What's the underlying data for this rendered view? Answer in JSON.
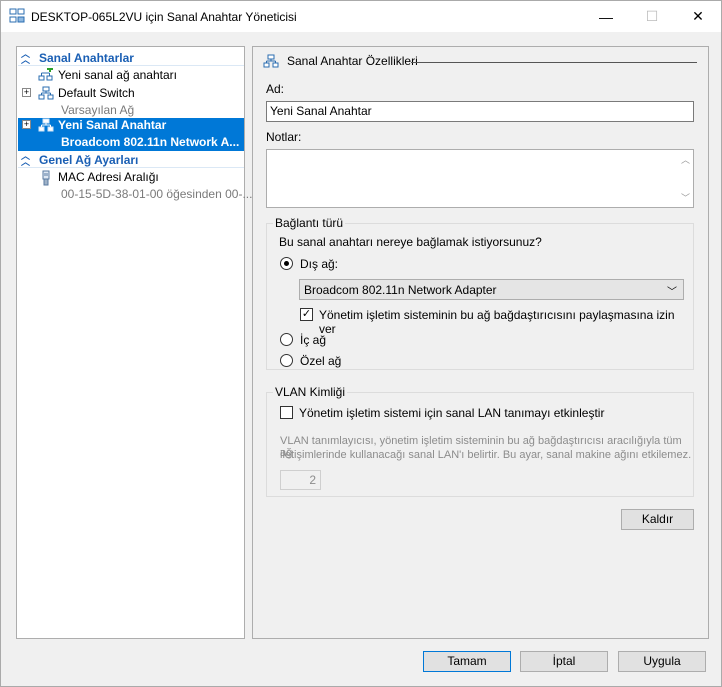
{
  "window": {
    "title": "DESKTOP-065L2VU için Sanal Anahtar Yöneticisi",
    "minimize": "—",
    "maximize": "☐",
    "close": "✕"
  },
  "tree": {
    "section1": "Sanal Anahtarlar",
    "new_switch": "Yeni sanal ağ anahtarı",
    "default_switch": "Default Switch",
    "default_switch_sub": "Varsayılan Ağ",
    "selected_switch": "Yeni Sanal Anahtar",
    "selected_switch_sub": "Broadcom 802.11n Network A...",
    "section2": "Genel Ağ Ayarları",
    "mac_range": "MAC Adresi Aralığı",
    "mac_range_sub": "00-15-5D-38-01-00 öğesinden 00-..."
  },
  "props": {
    "header": "Sanal Anahtar Özellikleri",
    "name_label": "Ad:",
    "name_value": "Yeni Sanal Anahtar",
    "notes_label": "Notlar:",
    "connection_group": "Bağlantı türü",
    "connection_question": "Bu sanal anahtarı nereye bağlamak istiyorsunuz?",
    "external": "Dış ağ:",
    "adapter": "Broadcom 802.11n Network Adapter",
    "allow_share": "Yönetim işletim sisteminin bu ağ bağdaştırıcısını paylaşmasına izin ver",
    "internal": "İç ağ",
    "private": "Özel ağ",
    "vlan_group": "VLAN Kimliği",
    "vlan_enable": "Yönetim işletim sistemi için sanal LAN tanımayı etkinleştir",
    "vlan_desc1": "VLAN tanımlayıcısı, yönetim işletim sisteminin bu ağ bağdaştırıcısı aracılığıyla tüm ağ",
    "vlan_desc2": "iletişimlerinde kullanacağı sanal LAN'ı belirtir. Bu ayar, sanal makine ağını etkilemez.",
    "vlan_value": "2",
    "remove": "Kaldır"
  },
  "footer": {
    "ok": "Tamam",
    "cancel": "İptal",
    "apply": "Uygula"
  },
  "colors": {
    "selection": "#0078d7",
    "section_header": "#1a5fb4"
  }
}
